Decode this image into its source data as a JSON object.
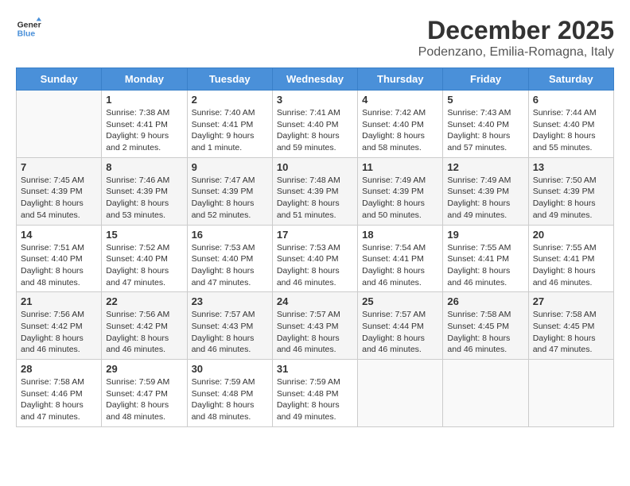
{
  "header": {
    "logo_line1": "General",
    "logo_line2": "Blue",
    "month": "December 2025",
    "location": "Podenzano, Emilia-Romagna, Italy"
  },
  "days_of_week": [
    "Sunday",
    "Monday",
    "Tuesday",
    "Wednesday",
    "Thursday",
    "Friday",
    "Saturday"
  ],
  "weeks": [
    [
      {
        "day": "",
        "info": ""
      },
      {
        "day": "1",
        "info": "Sunrise: 7:38 AM\nSunset: 4:41 PM\nDaylight: 9 hours\nand 2 minutes."
      },
      {
        "day": "2",
        "info": "Sunrise: 7:40 AM\nSunset: 4:41 PM\nDaylight: 9 hours\nand 1 minute."
      },
      {
        "day": "3",
        "info": "Sunrise: 7:41 AM\nSunset: 4:40 PM\nDaylight: 8 hours\nand 59 minutes."
      },
      {
        "day": "4",
        "info": "Sunrise: 7:42 AM\nSunset: 4:40 PM\nDaylight: 8 hours\nand 58 minutes."
      },
      {
        "day": "5",
        "info": "Sunrise: 7:43 AM\nSunset: 4:40 PM\nDaylight: 8 hours\nand 57 minutes."
      },
      {
        "day": "6",
        "info": "Sunrise: 7:44 AM\nSunset: 4:40 PM\nDaylight: 8 hours\nand 55 minutes."
      }
    ],
    [
      {
        "day": "7",
        "info": "Sunrise: 7:45 AM\nSunset: 4:39 PM\nDaylight: 8 hours\nand 54 minutes."
      },
      {
        "day": "8",
        "info": "Sunrise: 7:46 AM\nSunset: 4:39 PM\nDaylight: 8 hours\nand 53 minutes."
      },
      {
        "day": "9",
        "info": "Sunrise: 7:47 AM\nSunset: 4:39 PM\nDaylight: 8 hours\nand 52 minutes."
      },
      {
        "day": "10",
        "info": "Sunrise: 7:48 AM\nSunset: 4:39 PM\nDaylight: 8 hours\nand 51 minutes."
      },
      {
        "day": "11",
        "info": "Sunrise: 7:49 AM\nSunset: 4:39 PM\nDaylight: 8 hours\nand 50 minutes."
      },
      {
        "day": "12",
        "info": "Sunrise: 7:49 AM\nSunset: 4:39 PM\nDaylight: 8 hours\nand 49 minutes."
      },
      {
        "day": "13",
        "info": "Sunrise: 7:50 AM\nSunset: 4:39 PM\nDaylight: 8 hours\nand 49 minutes."
      }
    ],
    [
      {
        "day": "14",
        "info": "Sunrise: 7:51 AM\nSunset: 4:40 PM\nDaylight: 8 hours\nand 48 minutes."
      },
      {
        "day": "15",
        "info": "Sunrise: 7:52 AM\nSunset: 4:40 PM\nDaylight: 8 hours\nand 47 minutes."
      },
      {
        "day": "16",
        "info": "Sunrise: 7:53 AM\nSunset: 4:40 PM\nDaylight: 8 hours\nand 47 minutes."
      },
      {
        "day": "17",
        "info": "Sunrise: 7:53 AM\nSunset: 4:40 PM\nDaylight: 8 hours\nand 46 minutes."
      },
      {
        "day": "18",
        "info": "Sunrise: 7:54 AM\nSunset: 4:41 PM\nDaylight: 8 hours\nand 46 minutes."
      },
      {
        "day": "19",
        "info": "Sunrise: 7:55 AM\nSunset: 4:41 PM\nDaylight: 8 hours\nand 46 minutes."
      },
      {
        "day": "20",
        "info": "Sunrise: 7:55 AM\nSunset: 4:41 PM\nDaylight: 8 hours\nand 46 minutes."
      }
    ],
    [
      {
        "day": "21",
        "info": "Sunrise: 7:56 AM\nSunset: 4:42 PM\nDaylight: 8 hours\nand 46 minutes."
      },
      {
        "day": "22",
        "info": "Sunrise: 7:56 AM\nSunset: 4:42 PM\nDaylight: 8 hours\nand 46 minutes."
      },
      {
        "day": "23",
        "info": "Sunrise: 7:57 AM\nSunset: 4:43 PM\nDaylight: 8 hours\nand 46 minutes."
      },
      {
        "day": "24",
        "info": "Sunrise: 7:57 AM\nSunset: 4:43 PM\nDaylight: 8 hours\nand 46 minutes."
      },
      {
        "day": "25",
        "info": "Sunrise: 7:57 AM\nSunset: 4:44 PM\nDaylight: 8 hours\nand 46 minutes."
      },
      {
        "day": "26",
        "info": "Sunrise: 7:58 AM\nSunset: 4:45 PM\nDaylight: 8 hours\nand 46 minutes."
      },
      {
        "day": "27",
        "info": "Sunrise: 7:58 AM\nSunset: 4:45 PM\nDaylight: 8 hours\nand 47 minutes."
      }
    ],
    [
      {
        "day": "28",
        "info": "Sunrise: 7:58 AM\nSunset: 4:46 PM\nDaylight: 8 hours\nand 47 minutes."
      },
      {
        "day": "29",
        "info": "Sunrise: 7:59 AM\nSunset: 4:47 PM\nDaylight: 8 hours\nand 48 minutes."
      },
      {
        "day": "30",
        "info": "Sunrise: 7:59 AM\nSunset: 4:48 PM\nDaylight: 8 hours\nand 48 minutes."
      },
      {
        "day": "31",
        "info": "Sunrise: 7:59 AM\nSunset: 4:48 PM\nDaylight: 8 hours\nand 49 minutes."
      },
      {
        "day": "",
        "info": ""
      },
      {
        "day": "",
        "info": ""
      },
      {
        "day": "",
        "info": ""
      }
    ]
  ]
}
